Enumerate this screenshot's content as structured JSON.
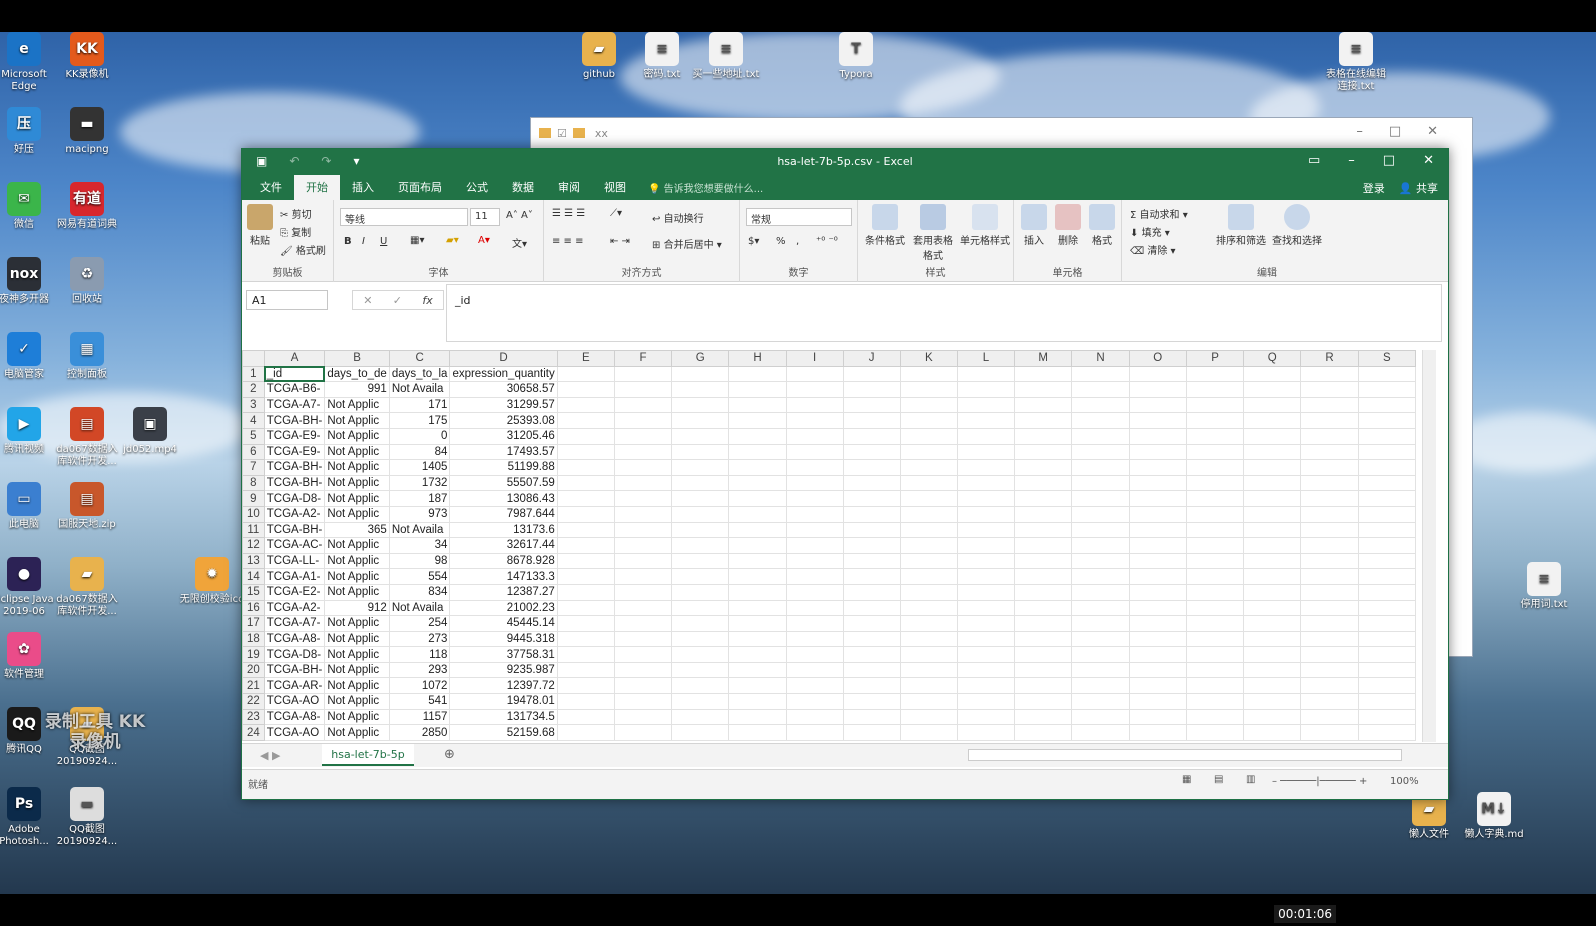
{
  "desktop": {
    "icons_left": [
      {
        "label": "Microsoft Edge",
        "color": "#1b73c6",
        "glyph": "e"
      },
      {
        "label": "KK录像机",
        "color": "#e35a1c",
        "glyph": "KK"
      },
      {
        "label": "好压",
        "color": "#2f8ad6",
        "glyph": "压"
      },
      {
        "label": "macipng",
        "color": "#333333",
        "glyph": "▬"
      },
      {
        "label": "微信",
        "color": "#3bb54a",
        "glyph": "✉"
      },
      {
        "label": "网易有道词典",
        "color": "#d8272d",
        "glyph": "有道"
      },
      {
        "label": "夜神多开器",
        "color": "#2b2f36",
        "glyph": "nox"
      },
      {
        "label": "回收站",
        "color": "#8a9bb0",
        "glyph": "♻"
      },
      {
        "label": "电脑管家",
        "color": "#1e7ed8",
        "glyph": "✓"
      },
      {
        "label": "控制面板",
        "color": "#3a8fd9",
        "glyph": "▦"
      },
      {
        "label": "腾讯视频",
        "color": "#22a5e8",
        "glyph": "▶"
      },
      {
        "label": "da067数据入库软件开发...",
        "color": "#d24726",
        "glyph": "▤"
      },
      {
        "label": "jd052.mp4",
        "color": "#3a3f48",
        "glyph": "▣"
      },
      {
        "label": "此电脑",
        "color": "#3b7fd0",
        "glyph": "▭"
      },
      {
        "label": "国服天地.zip",
        "color": "#c8572b",
        "glyph": "▤"
      },
      {
        "label": "Eclipse Java 2019-06",
        "color": "#2c2255",
        "glyph": "●"
      },
      {
        "label": "da067数据入库软件开发...",
        "color": "#e8b24d",
        "glyph": "▰"
      },
      {
        "label": "无限创校验ico",
        "color": "#f0a43a",
        "glyph": "✹"
      },
      {
        "label": "软件管理",
        "color": "#ea4c89",
        "glyph": "✿"
      },
      {
        "label": "腾讯QQ",
        "color": "#1a1a1a",
        "glyph": "QQ"
      },
      {
        "label": "QQ截图 20190924...",
        "color": "#e8b24d",
        "glyph": "▰"
      },
      {
        "label": "Adobe Photosh...",
        "color": "#0b2a4a",
        "glyph": "Ps"
      },
      {
        "label": "QQ截图 20190924...",
        "color": "#dddddd",
        "glyph": "▬"
      }
    ],
    "icons_top": [
      {
        "label": "github",
        "color": "#e8b24d",
        "glyph": "▰"
      },
      {
        "label": "密码.txt",
        "color": "#f2f2f2",
        "glyph": "≡"
      },
      {
        "label": "买一些地址.txt",
        "color": "#f2f2f2",
        "glyph": "≡"
      },
      {
        "label": "Typora",
        "color": "#f2f2f2",
        "glyph": "T"
      },
      {
        "label": "表格在线编辑连接.txt",
        "color": "#f2f2f2",
        "glyph": "≡"
      }
    ],
    "icons_right": [
      {
        "label": "停用词.txt",
        "color": "#f2f2f2",
        "glyph": "≡"
      },
      {
        "label": "懒人文件",
        "color": "#e8b24d",
        "glyph": "▰"
      },
      {
        "label": "懒人字典.md",
        "color": "#f2f2f2",
        "glyph": "M↓"
      }
    ],
    "watermark": "录制工具 KK录像机",
    "timer": "00:01:06"
  },
  "explorer": {
    "title": "xx"
  },
  "excel": {
    "title": "hsa-let-7b-5p.csv - Excel",
    "tabs": [
      "文件",
      "开始",
      "插入",
      "页面布局",
      "公式",
      "数据",
      "审阅",
      "视图"
    ],
    "active_tab": "开始",
    "tell_me": "告诉我您想要做什么...",
    "login": "登录",
    "share": "共享",
    "ribbon": {
      "clipboard": {
        "paste": "粘贴",
        "cut": "剪切",
        "copy": "复制",
        "format_painter": "格式刷",
        "label": "剪贴板"
      },
      "font": {
        "name": "等线",
        "size": "11",
        "bold": "B",
        "italic": "I",
        "underline": "U",
        "label": "字体"
      },
      "alignment": {
        "wrap": "自动换行",
        "merge": "合并后居中",
        "label": "对齐方式"
      },
      "number": {
        "format": "常规",
        "percent": "%",
        "comma": ",",
        "label": "数字"
      },
      "styles": {
        "conditional": "条件格式",
        "table": "套用表格格式",
        "cell_styles": "单元格样式",
        "label": "样式"
      },
      "cells": {
        "insert": "插入",
        "delete": "删除",
        "format": "格式",
        "label": "单元格"
      },
      "editing": {
        "autosum": "自动求和",
        "fill": "填充",
        "clear": "清除",
        "sort": "排序和筛选",
        "find": "查找和选择",
        "label": "编辑"
      }
    },
    "namebox": "A1",
    "formula": "_id",
    "columns": [
      "A",
      "B",
      "C",
      "D",
      "E",
      "F",
      "G",
      "H",
      "I",
      "J",
      "K",
      "L",
      "M",
      "N",
      "O",
      "P",
      "Q",
      "R",
      "S"
    ],
    "rows": [
      [
        "_id",
        "days_to_de",
        "days_to_la",
        "expression_quantity"
      ],
      [
        "TCGA-B6-",
        "991",
        "Not Availa",
        "30658.57"
      ],
      [
        "TCGA-A7-",
        "Not Applic",
        "171",
        "31299.57"
      ],
      [
        "TCGA-BH-",
        "Not Applic",
        "175",
        "25393.08"
      ],
      [
        "TCGA-E9-",
        "Not Applic",
        "0",
        "31205.46"
      ],
      [
        "TCGA-E9-",
        "Not Applic",
        "84",
        "17493.57"
      ],
      [
        "TCGA-BH-",
        "Not Applic",
        "1405",
        "51199.88"
      ],
      [
        "TCGA-BH-",
        "Not Applic",
        "1732",
        "55507.59"
      ],
      [
        "TCGA-D8-",
        "Not Applic",
        "187",
        "13086.43"
      ],
      [
        "TCGA-A2-",
        "Not Applic",
        "973",
        "7987.644"
      ],
      [
        "TCGA-BH-",
        "365",
        "Not Availa",
        "13173.6"
      ],
      [
        "TCGA-AC-",
        "Not Applic",
        "34",
        "32617.44"
      ],
      [
        "TCGA-LL-",
        "Not Applic",
        "98",
        "8678.928"
      ],
      [
        "TCGA-A1-",
        "Not Applic",
        "554",
        "147133.3"
      ],
      [
        "TCGA-E2-",
        "Not Applic",
        "834",
        "12387.27"
      ],
      [
        "TCGA-A2-",
        "912",
        "Not Availa",
        "21002.23"
      ],
      [
        "TCGA-A7-",
        "Not Applic",
        "254",
        "45445.14"
      ],
      [
        "TCGA-A8-",
        "Not Applic",
        "273",
        "9445.318"
      ],
      [
        "TCGA-D8-",
        "Not Applic",
        "118",
        "37758.31"
      ],
      [
        "TCGA-BH-",
        "Not Applic",
        "293",
        "9235.987"
      ],
      [
        "TCGA-AR-",
        "Not Applic",
        "1072",
        "12397.72"
      ],
      [
        "TCGA-AO",
        "Not Applic",
        "541",
        "19478.01"
      ],
      [
        "TCGA-A8-",
        "Not Applic",
        "1157",
        "131734.5"
      ],
      [
        "TCGA-AO",
        "Not Applic",
        "2850",
        "52159.68"
      ]
    ],
    "sheet_tab": "hsa-let-7b-5p",
    "status": "就绪",
    "zoom": "100%"
  }
}
